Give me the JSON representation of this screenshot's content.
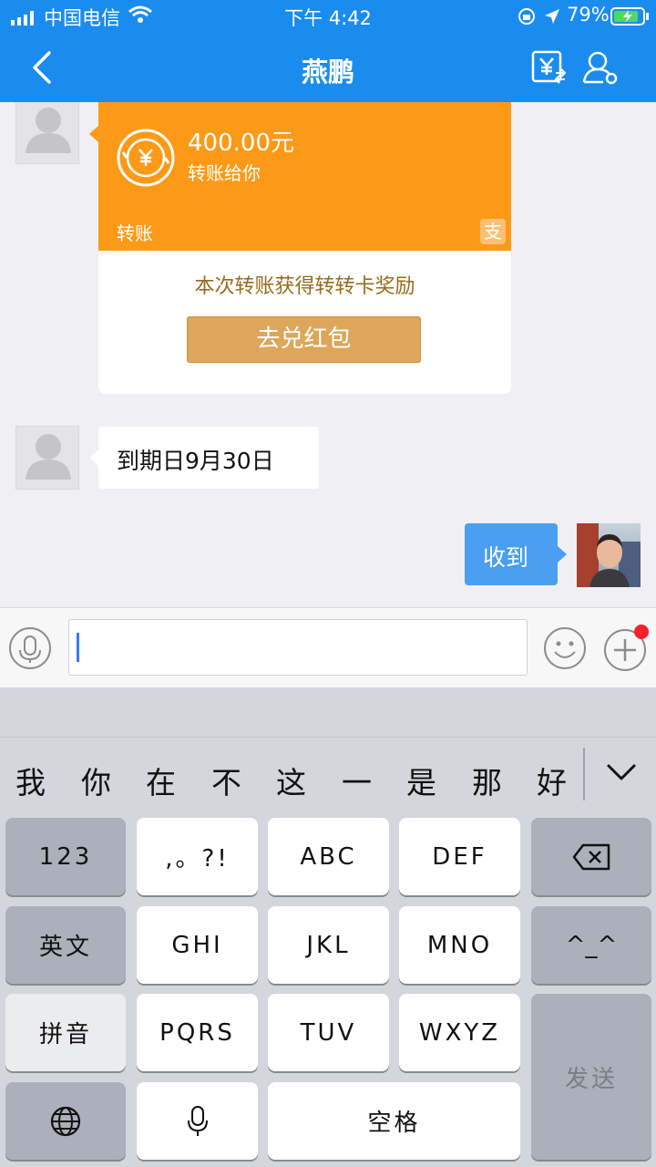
{
  "status_bar": {
    "carrier": "中国电信",
    "time": "下午 4:42",
    "battery": "79%"
  },
  "header": {
    "title": "燕鹏"
  },
  "transfer_card": {
    "amount": "400.00元",
    "subtitle": "转账给你",
    "type_label": "转账",
    "reward_text": "本次转账获得转转卡奖励",
    "redeem_button": "去兑红包",
    "badge": "支"
  },
  "messages": [
    {
      "text": "到期日9月30日"
    },
    {
      "text": "收到"
    }
  ],
  "keyboard": {
    "candidates": [
      "我",
      "你",
      "在",
      "不",
      "这",
      "一",
      "是",
      "那",
      "好"
    ],
    "keys": {
      "num": "123",
      "punct": ",。?!",
      "abc": "ABC",
      "def": "DEF",
      "lang_en": "英文",
      "ghi": "GHI",
      "jkl": "JKL",
      "mno": "MNO",
      "emoticon": "^_^",
      "pinyin": "拼音",
      "pqrs": "PQRS",
      "tuv": "TUV",
      "wxyz": "WXYZ",
      "send": "发送",
      "space": "空格"
    }
  },
  "colors": {
    "header_blue": "#1a8cf0",
    "transfer_orange": "#fc9a17",
    "redeem_gold": "#dea65a",
    "bubble_blue": "#4a9ff0"
  }
}
